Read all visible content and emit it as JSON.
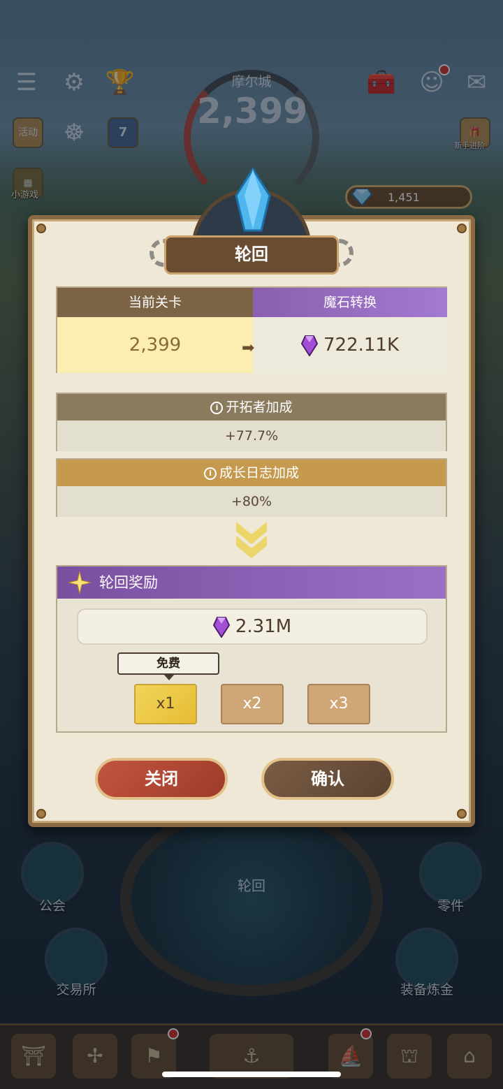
{
  "top": {
    "city_name": "摩尔城",
    "city_level": "2,399",
    "activity_label": "活动",
    "newbie_pack_label": "新手进阶",
    "minigame_label": "小游戏",
    "calendar_day": "7",
    "gems": "1,451"
  },
  "dialog": {
    "title": "轮回",
    "current_stage_label": "当前关卡",
    "conversion_label": "魔石转换",
    "current_stage_value": "2,399",
    "conversion_value": "722.11K",
    "pioneer_bonus_label": "开拓者加成",
    "pioneer_bonus_value": "+77.7%",
    "growth_log_bonus_label": "成长日志加成",
    "growth_log_bonus_value": "+80%",
    "reward_title": "轮回奖励",
    "reward_value": "2.31M",
    "free_tip": "免费",
    "multipliers": [
      "x1",
      "x2",
      "x3"
    ],
    "close_label": "关闭",
    "confirm_label": "确认"
  },
  "bottom": {
    "compass_label": "轮回",
    "guild_label": "公会",
    "parts_label": "零件",
    "exchange_label": "交易所",
    "alchemy_label": "装备炼金"
  },
  "colors": {
    "brown": "#7c6346",
    "purple": "#8a5fb0",
    "gold": "#c99a45",
    "yellow_cell": "#fbeeb0"
  }
}
